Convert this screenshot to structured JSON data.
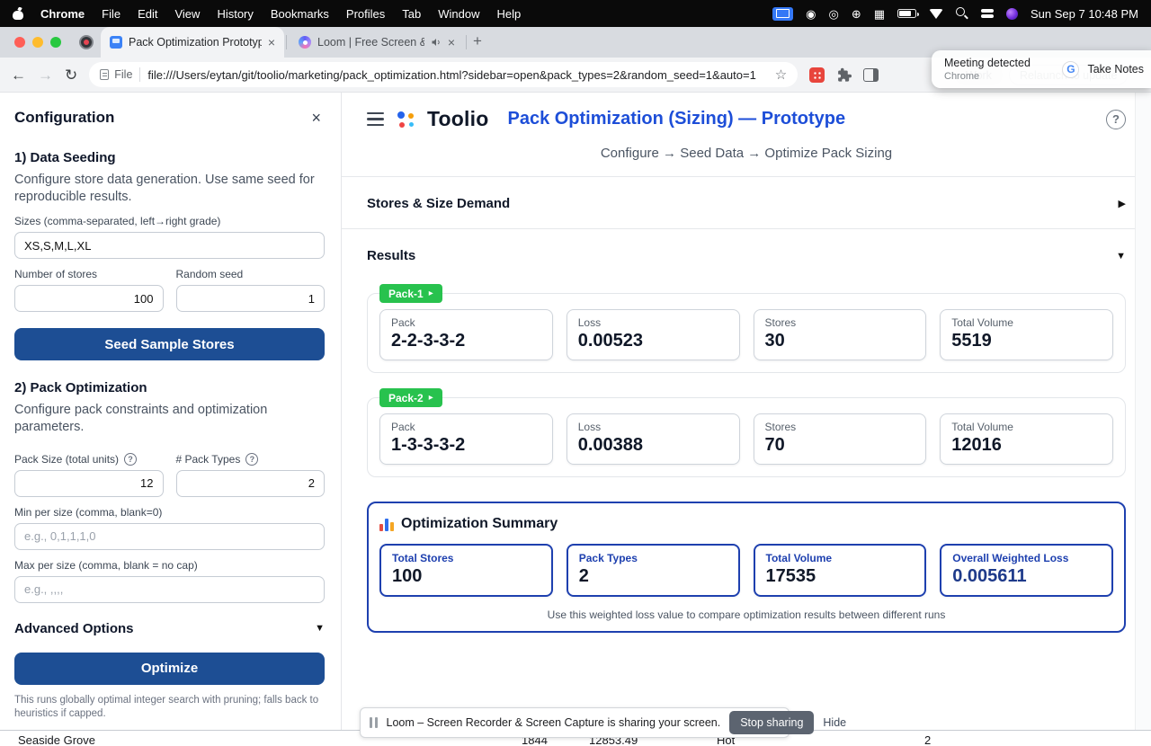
{
  "menubar": {
    "items": [
      "Chrome",
      "File",
      "Edit",
      "View",
      "History",
      "Bookmarks",
      "Profiles",
      "Tab",
      "Window",
      "Help"
    ],
    "clock": "Sun Sep 7 10:48 PM"
  },
  "tabs": {
    "active": "Pack Optimization Prototype",
    "inactive": "Loom | Free Screen & Vid..."
  },
  "toolbar": {
    "file_chip": "File",
    "url": "file:///Users/eytan/git/toolio/marketing/pack_optimization.html?sidebar=open&pack_types=2&random_seed=1&auto=1",
    "work_chip": "Work",
    "relaunch": "Relaunch to update"
  },
  "notification": {
    "title": "Meeting detected",
    "app": "Chrome",
    "action": "Take Notes"
  },
  "sidebar": {
    "title": "Configuration",
    "section1": {
      "heading": "1) Data Seeding",
      "description": "Configure store data generation. Use same seed for reproducible results.",
      "sizes_label": "Sizes (comma-separated, left→right grade)",
      "sizes_value": "XS,S,M,L,XL",
      "stores_label": "Number of stores",
      "stores_value": "100",
      "seed_label": "Random seed",
      "seed_value": "1",
      "seed_button": "Seed Sample Stores"
    },
    "section2": {
      "heading": "2) Pack Optimization",
      "description": "Configure pack constraints and optimization parameters.",
      "pack_size_label": "Pack Size (total units)",
      "pack_size_value": "12",
      "pack_types_label": "# Pack Types",
      "pack_types_value": "2",
      "min_label": "Min per size (comma, blank=0)",
      "min_placeholder": "e.g., 0,1,1,1,0",
      "max_label": "Max per size (comma, blank = no cap)",
      "max_placeholder": "e.g., ,,,,",
      "advanced": "Advanced Options",
      "optimize_button": "Optimize",
      "footnote": "This runs globally optimal integer search with pruning; falls back to heuristics if capped."
    }
  },
  "main": {
    "brand": "Toolio",
    "title": "Pack Optimization (Sizing) — Prototype",
    "breadcrumb": "Configure → Seed Data → Optimize Pack Sizing",
    "stores_section": "Stores & Size Demand",
    "results_section": "Results",
    "packs": [
      {
        "badge": "Pack-1",
        "stats": [
          {
            "label": "Pack",
            "value": "2-2-3-3-2"
          },
          {
            "label": "Loss",
            "value": "0.00523"
          },
          {
            "label": "Stores",
            "value": "30"
          },
          {
            "label": "Total Volume",
            "value": "5519"
          }
        ]
      },
      {
        "badge": "Pack-2",
        "stats": [
          {
            "label": "Pack",
            "value": "1-3-3-3-2"
          },
          {
            "label": "Loss",
            "value": "0.00388"
          },
          {
            "label": "Stores",
            "value": "70"
          },
          {
            "label": "Total Volume",
            "value": "12016"
          }
        ]
      }
    ],
    "summary": {
      "title": "Optimization Summary",
      "stats": [
        {
          "label": "Total Stores",
          "value": "100"
        },
        {
          "label": "Pack Types",
          "value": "2"
        },
        {
          "label": "Total Volume",
          "value": "17535"
        },
        {
          "label": "Overall Weighted Loss",
          "value": "0.005611"
        }
      ],
      "note": "Use this weighted loss value to compare optimization results between different runs"
    }
  },
  "loom_bar": {
    "text": "Loom – Screen Recorder & Screen Capture is sharing your screen.",
    "stop": "Stop sharing",
    "hide": "Hide"
  },
  "bottom_row": {
    "cells": [
      "Seaside Grove",
      "1844",
      "12853.49",
      "Hot",
      "2"
    ]
  },
  "colors": {
    "primary_button": "#1d4e94",
    "title_blue": "#1d4ed8",
    "badge_green": "#28c24e",
    "summary_blue": "#1e40af"
  }
}
